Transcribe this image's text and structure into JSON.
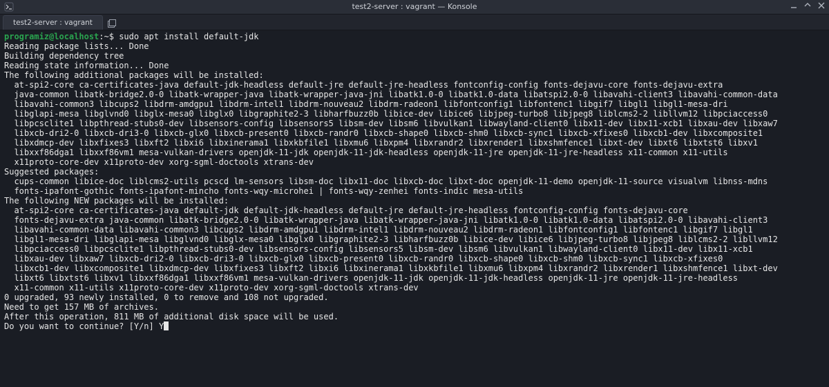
{
  "window": {
    "title": "test2-server : vagrant — Konsole"
  },
  "tab": {
    "label": "test2-server : vagrant"
  },
  "prompt": {
    "user_host": "programiz@localhost",
    "separator": ":",
    "path_sym": "~$",
    "command": "sudo apt install default-jdk"
  },
  "output_lines": [
    "Reading package lists... Done",
    "Building dependency tree",
    "Reading state information... Done",
    "The following additional packages will be installed:",
    "  at-spi2-core ca-certificates-java default-jdk-headless default-jre default-jre-headless fontconfig-config fonts-dejavu-core fonts-dejavu-extra",
    "  java-common libatk-bridge2.0-0 libatk-wrapper-java libatk-wrapper-java-jni libatk1.0-0 libatk1.0-data libatspi2.0-0 libavahi-client3 libavahi-common-data",
    "  libavahi-common3 libcups2 libdrm-amdgpu1 libdrm-intel1 libdrm-nouveau2 libdrm-radeon1 libfontconfig1 libfontenc1 libgif7 libgl1 libgl1-mesa-dri",
    "  libglapi-mesa libglvnd0 libglx-mesa0 libglx0 libgraphite2-3 libharfbuzz0b libice-dev libice6 libjpeg-turbo8 libjpeg8 liblcms2-2 libllvm12 libpciaccess0",
    "  libpcsclite1 libpthread-stubs0-dev libsensors-config libsensors5 libsm-dev libsm6 libvulkan1 libwayland-client0 libx11-dev libx11-xcb1 libxau-dev libxaw7",
    "  libxcb-dri2-0 libxcb-dri3-0 libxcb-glx0 libxcb-present0 libxcb-randr0 libxcb-shape0 libxcb-shm0 libxcb-sync1 libxcb-xfixes0 libxcb1-dev libxcomposite1",
    "  libxdmcp-dev libxfixes3 libxft2 libxi6 libxinerama1 libxkbfile1 libxmu6 libxpm4 libxrandr2 libxrender1 libxshmfence1 libxt-dev libxt6 libxtst6 libxv1",
    "  libxxf86dga1 libxxf86vm1 mesa-vulkan-drivers openjdk-11-jdk openjdk-11-jdk-headless openjdk-11-jre openjdk-11-jre-headless x11-common x11-utils",
    "  x11proto-core-dev x11proto-dev xorg-sgml-doctools xtrans-dev",
    "Suggested packages:",
    "  cups-common libice-doc liblcms2-utils pcscd lm-sensors libsm-doc libx11-doc libxcb-doc libxt-doc openjdk-11-demo openjdk-11-source visualvm libnss-mdns",
    "  fonts-ipafont-gothic fonts-ipafont-mincho fonts-wqy-microhei | fonts-wqy-zenhei fonts-indic mesa-utils",
    "The following NEW packages will be installed:",
    "  at-spi2-core ca-certificates-java default-jdk default-jdk-headless default-jre default-jre-headless fontconfig-config fonts-dejavu-core",
    "  fonts-dejavu-extra java-common libatk-bridge2.0-0 libatk-wrapper-java libatk-wrapper-java-jni libatk1.0-0 libatk1.0-data libatspi2.0-0 libavahi-client3",
    "  libavahi-common-data libavahi-common3 libcups2 libdrm-amdgpu1 libdrm-intel1 libdrm-nouveau2 libdrm-radeon1 libfontconfig1 libfontenc1 libgif7 libgl1",
    "  libgl1-mesa-dri libglapi-mesa libglvnd0 libglx-mesa0 libglx0 libgraphite2-3 libharfbuzz0b libice-dev libice6 libjpeg-turbo8 libjpeg8 liblcms2-2 libllvm12",
    "  libpciaccess0 libpcsclite1 libpthread-stubs0-dev libsensors-config libsensors5 libsm-dev libsm6 libvulkan1 libwayland-client0 libx11-dev libx11-xcb1",
    "  libxau-dev libxaw7 libxcb-dri2-0 libxcb-dri3-0 libxcb-glx0 libxcb-present0 libxcb-randr0 libxcb-shape0 libxcb-shm0 libxcb-sync1 libxcb-xfixes0",
    "  libxcb1-dev libxcomposite1 libxdmcp-dev libxfixes3 libxft2 libxi6 libxinerama1 libxkbfile1 libxmu6 libxpm4 libxrandr2 libxrender1 libxshmfence1 libxt-dev",
    "  libxt6 libxtst6 libxv1 libxxf86dga1 libxxf86vm1 mesa-vulkan-drivers openjdk-11-jdk openjdk-11-jdk-headless openjdk-11-jre openjdk-11-jre-headless",
    "  x11-common x11-utils x11proto-core-dev x11proto-dev xorg-sgml-doctools xtrans-dev",
    "0 upgraded, 93 newly installed, 0 to remove and 108 not upgraded.",
    "Need to get 157 MB of archives.",
    "After this operation, 811 MB of additional disk space will be used."
  ],
  "confirm": {
    "question": "Do you want to continue? [Y/n] ",
    "answer": "Y"
  }
}
